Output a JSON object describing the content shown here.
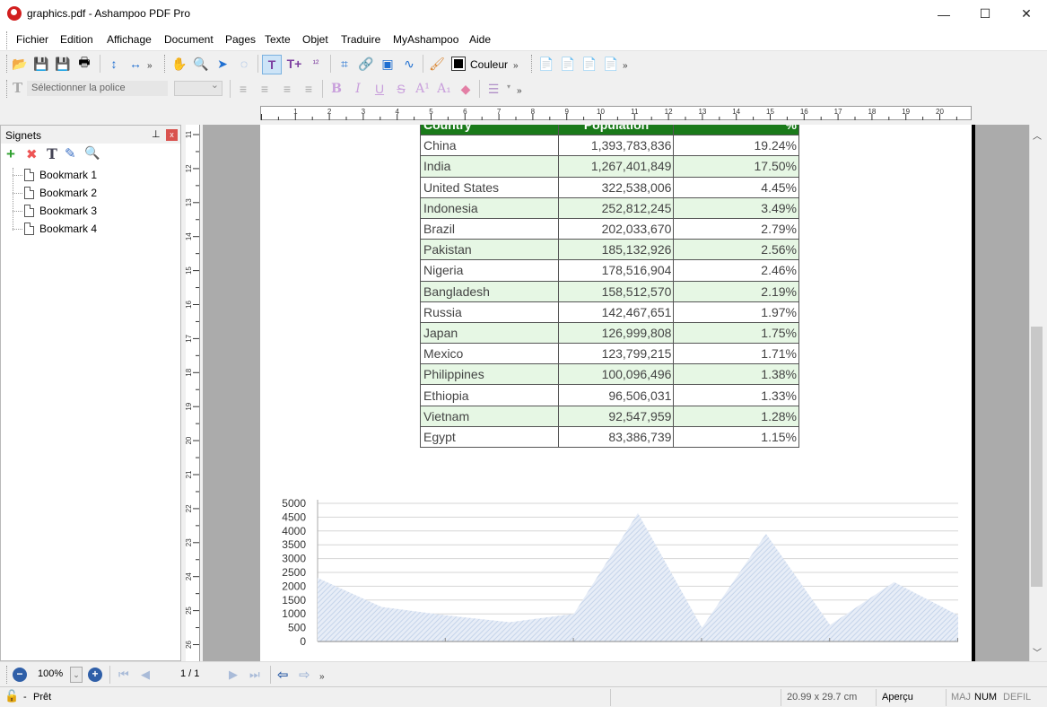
{
  "window": {
    "title": "graphics.pdf - Ashampoo PDF Pro",
    "minimize_glyph": "—",
    "maximize_glyph": "☐",
    "close_glyph": "✕"
  },
  "menu": [
    "Fichier",
    "Edition",
    "Affichage",
    "Document",
    "Pages",
    "Texte",
    "Objet",
    "Traduire",
    "MyAshampoo",
    "Aide"
  ],
  "toolbar": {
    "color_label": "Couleur",
    "font_placeholder": "Sélectionner la police",
    "overflow": "»"
  },
  "bookmarks_panel": {
    "title": "Signets",
    "pin": "📌",
    "close": "x",
    "items": [
      "Bookmark 1",
      "Bookmark 2",
      "Bookmark 3",
      "Bookmark 4"
    ]
  },
  "ruler": {
    "top_ticks": [
      "1",
      "2",
      "3",
      "4",
      "5",
      "6",
      "7",
      "8",
      "9",
      "10",
      "11",
      "12",
      "13",
      "14",
      "15",
      "16",
      "17",
      "18",
      "19",
      "20"
    ],
    "left_ticks": [
      "11",
      "12",
      "13",
      "14",
      "15",
      "16",
      "17",
      "18",
      "19",
      "20",
      "21",
      "22",
      "23",
      "24",
      "25",
      "26"
    ]
  },
  "table": {
    "header": [
      "Country",
      "Population",
      "%"
    ],
    "rows": [
      [
        "China",
        "1,393,783,836",
        "19.24%"
      ],
      [
        "India",
        "1,267,401,849",
        "17.50%"
      ],
      [
        "United States",
        "322,538,006",
        "4.45%"
      ],
      [
        "Indonesia",
        "252,812,245",
        "3.49%"
      ],
      [
        "Brazil",
        "202,033,670",
        "2.79%"
      ],
      [
        "Pakistan",
        "185,132,926",
        "2.56%"
      ],
      [
        "Nigeria",
        "178,516,904",
        "2.46%"
      ],
      [
        "Bangladesh",
        "158,512,570",
        "2.19%"
      ],
      [
        "Russia",
        "142,467,651",
        "1.97%"
      ],
      [
        "Japan",
        "126,999,808",
        "1.75%"
      ],
      [
        "Mexico",
        "123,799,215",
        "1.71%"
      ],
      [
        "Philippines",
        "100,096,496",
        "1.38%"
      ],
      [
        "Ethiopia",
        "96,506,031",
        "1.33%"
      ],
      [
        "Vietnam",
        "92,547,959",
        "1.28%"
      ],
      [
        "Egypt",
        "83,386,739",
        "1.15%"
      ]
    ],
    "header_color": "#1a7a1a",
    "alt_row_color": "#e6f7e4"
  },
  "chart_data": {
    "type": "area",
    "ylim": [
      0,
      5000
    ],
    "yticks": [
      "0",
      "500",
      "1000",
      "1500",
      "2000",
      "2500",
      "3000",
      "3500",
      "4000",
      "4500",
      "5000"
    ],
    "x": [
      0,
      1,
      2,
      3,
      4,
      5,
      6,
      7,
      8,
      9,
      10
    ],
    "values": [
      2300,
      1250,
      950,
      700,
      1000,
      4650,
      500,
      3900,
      600,
      2150,
      950
    ],
    "fill_color": "#c5d4ea",
    "grid": true
  },
  "navigation": {
    "zoom": "100%",
    "page": "1 / 1",
    "overflow": "»"
  },
  "status": {
    "state": "Prêt",
    "separator": "-",
    "page_size": "20.99 x 29.7 cm",
    "mode": "Aperçu",
    "maj": "MAJ",
    "num": "NUM",
    "defil": "DEFIL"
  }
}
